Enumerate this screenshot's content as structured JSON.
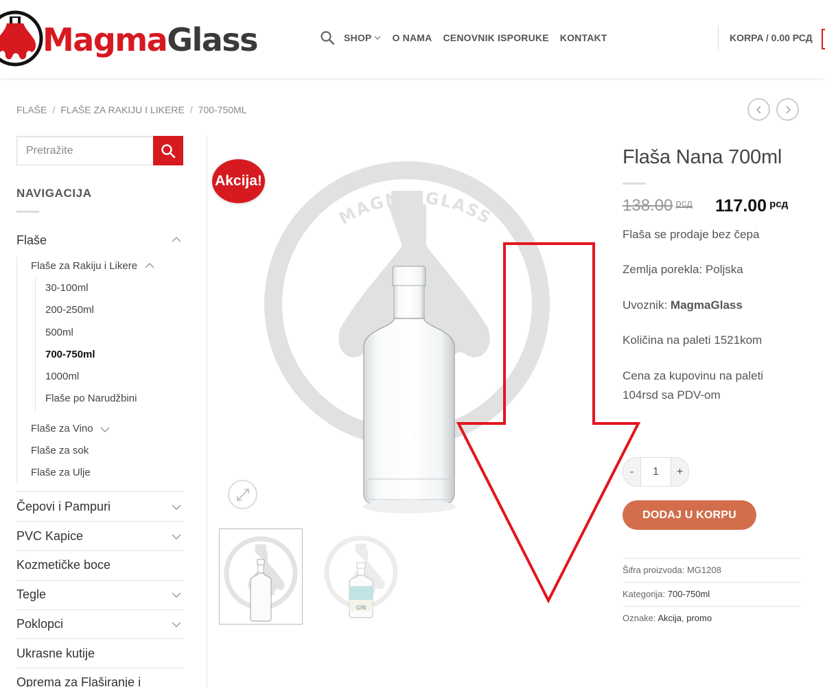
{
  "header": {
    "logo_magma": "Magma",
    "logo_glass": "Glass",
    "nav": [
      "SHOP",
      "O NAMA",
      "CENOVNIK ISPORUKE",
      "KONTAKT"
    ],
    "cart": "KORPA / 0.00 РСД"
  },
  "breadcrumb": [
    "FLAŠE",
    "FLAŠE ZA RAKIJU I LIKERE",
    "700-750ML"
  ],
  "sidebar": {
    "search_placeholder": "Pretražite",
    "heading": "NAVIGACIJA",
    "categories": {
      "flase": "Flaše",
      "rakija": "Flaše za Rakiju i Likere",
      "rakija_sizes": [
        "30-100ml",
        "200-250ml",
        "500ml",
        "700-750ml",
        "1000ml",
        "Flaše po Narudžbini"
      ],
      "vino": "Flaše za Vino",
      "sok": "Flaše za sok",
      "ulje": "Flaše za Ulje",
      "cepovi": "Čepovi i Pampuri",
      "pvc": "PVC Kapice",
      "kozmeticke": "Kozmetičke boce",
      "tegle": "Tegle",
      "poklopci": "Poklopci",
      "kutije": "Ukrasne kutije",
      "oprema": "Oprema za Flaširanje i"
    }
  },
  "product": {
    "badge": "Akcija!",
    "watermark": "MAGMA GLASS",
    "thumb_label": "GIN",
    "title": "Flaša Nana 700ml",
    "price_old": "138.00",
    "price_new": "117.00",
    "currency": "рсд",
    "desc1": "Flaša se prodaje bez čepa",
    "desc2": "Zemlja porekla: Poljska",
    "importer_label": "Uvoznik: ",
    "importer": "MagmaGlass",
    "pallet_qty": "Količina na paleti 1521kom",
    "pallet_price": "Cena za kupovinu na paleti 104rsd sa PDV-om",
    "qty_minus": "-",
    "qty_value": "1",
    "qty_plus": "+",
    "add_to_cart": "DODAJ U KORPU",
    "sku_label": "Šifra proizvoda: ",
    "sku": "MG1208",
    "category_label": "Kategorija: ",
    "category": "700-750ml",
    "tags_label": "Oznake: ",
    "tag1": "Akcija",
    "tag2": "promo"
  },
  "colors": {
    "brand_red": "#d71920",
    "button_orange": "#d26e4b",
    "annotation_red": "#e3161e"
  }
}
